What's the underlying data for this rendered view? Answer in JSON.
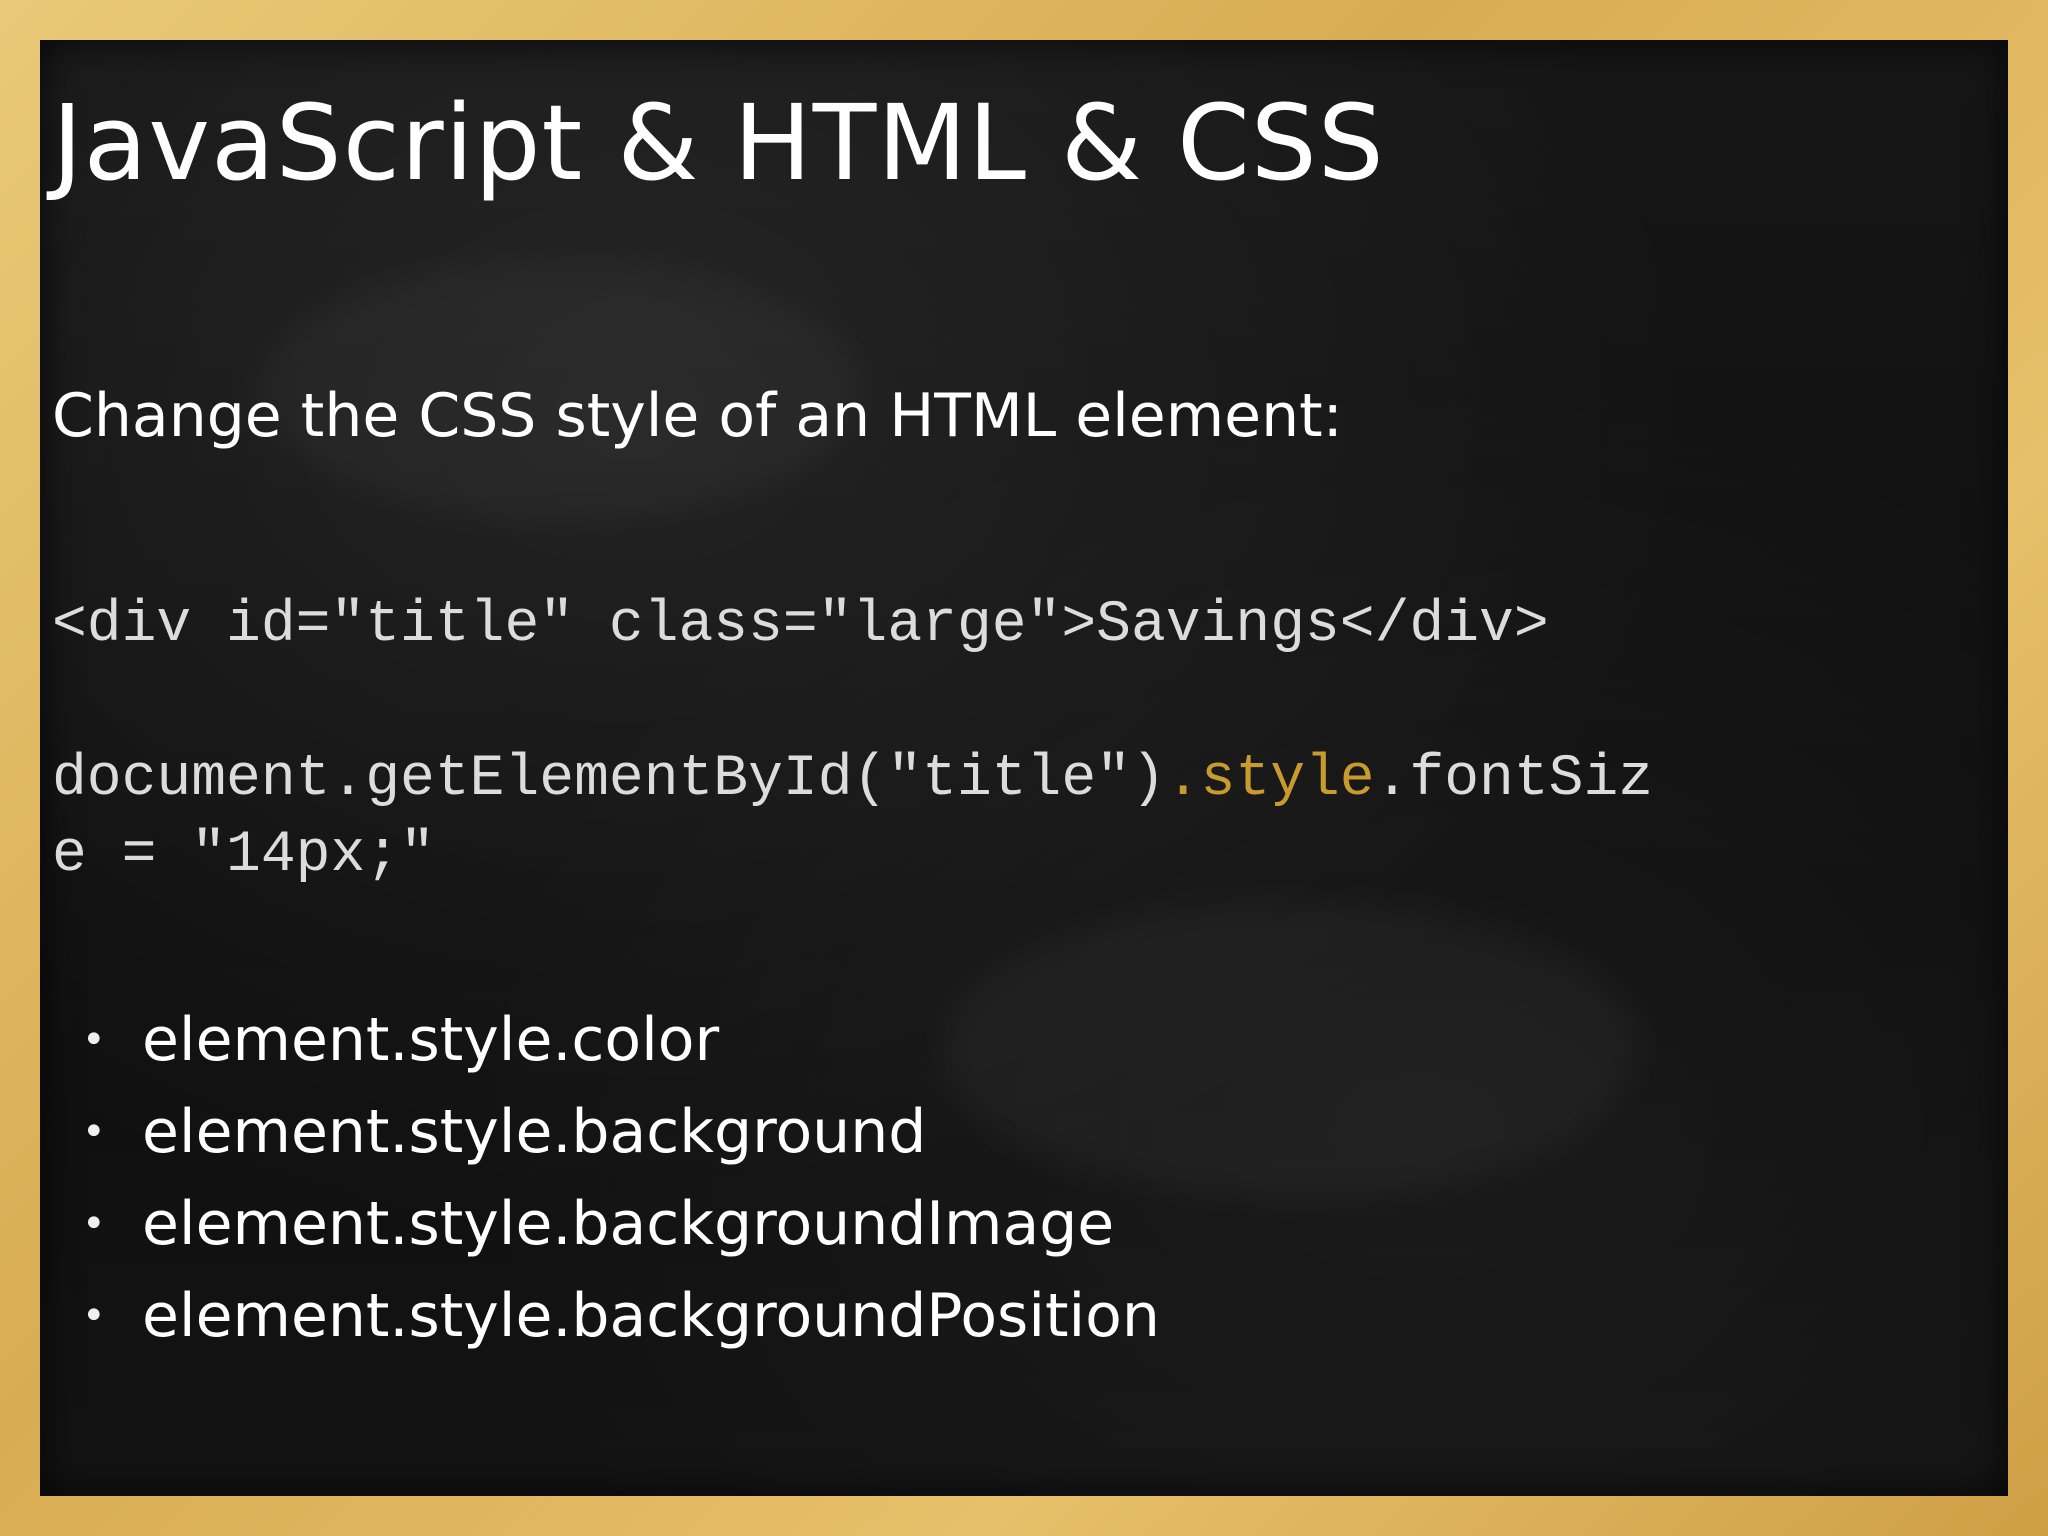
{
  "slide": {
    "title": "JavaScript & HTML & CSS",
    "subtitle": "Change the CSS style of an HTML element:",
    "code_html": "<div id=\"title\" class=\"large\">Savings</div>",
    "code_js": {
      "before": "document.getElementById(\"title\")",
      "highlight": ".style",
      "after_line1": ".fontSiz",
      "line2": "e = \"14px;\""
    },
    "bullets": [
      "element.style.color",
      "element.style.background",
      "element.style.backgroundImage",
      "element.style.backgroundPosition"
    ],
    "colors": {
      "frame": "#d8ac52",
      "board": "#121212",
      "highlight": "#c99a2e"
    }
  }
}
